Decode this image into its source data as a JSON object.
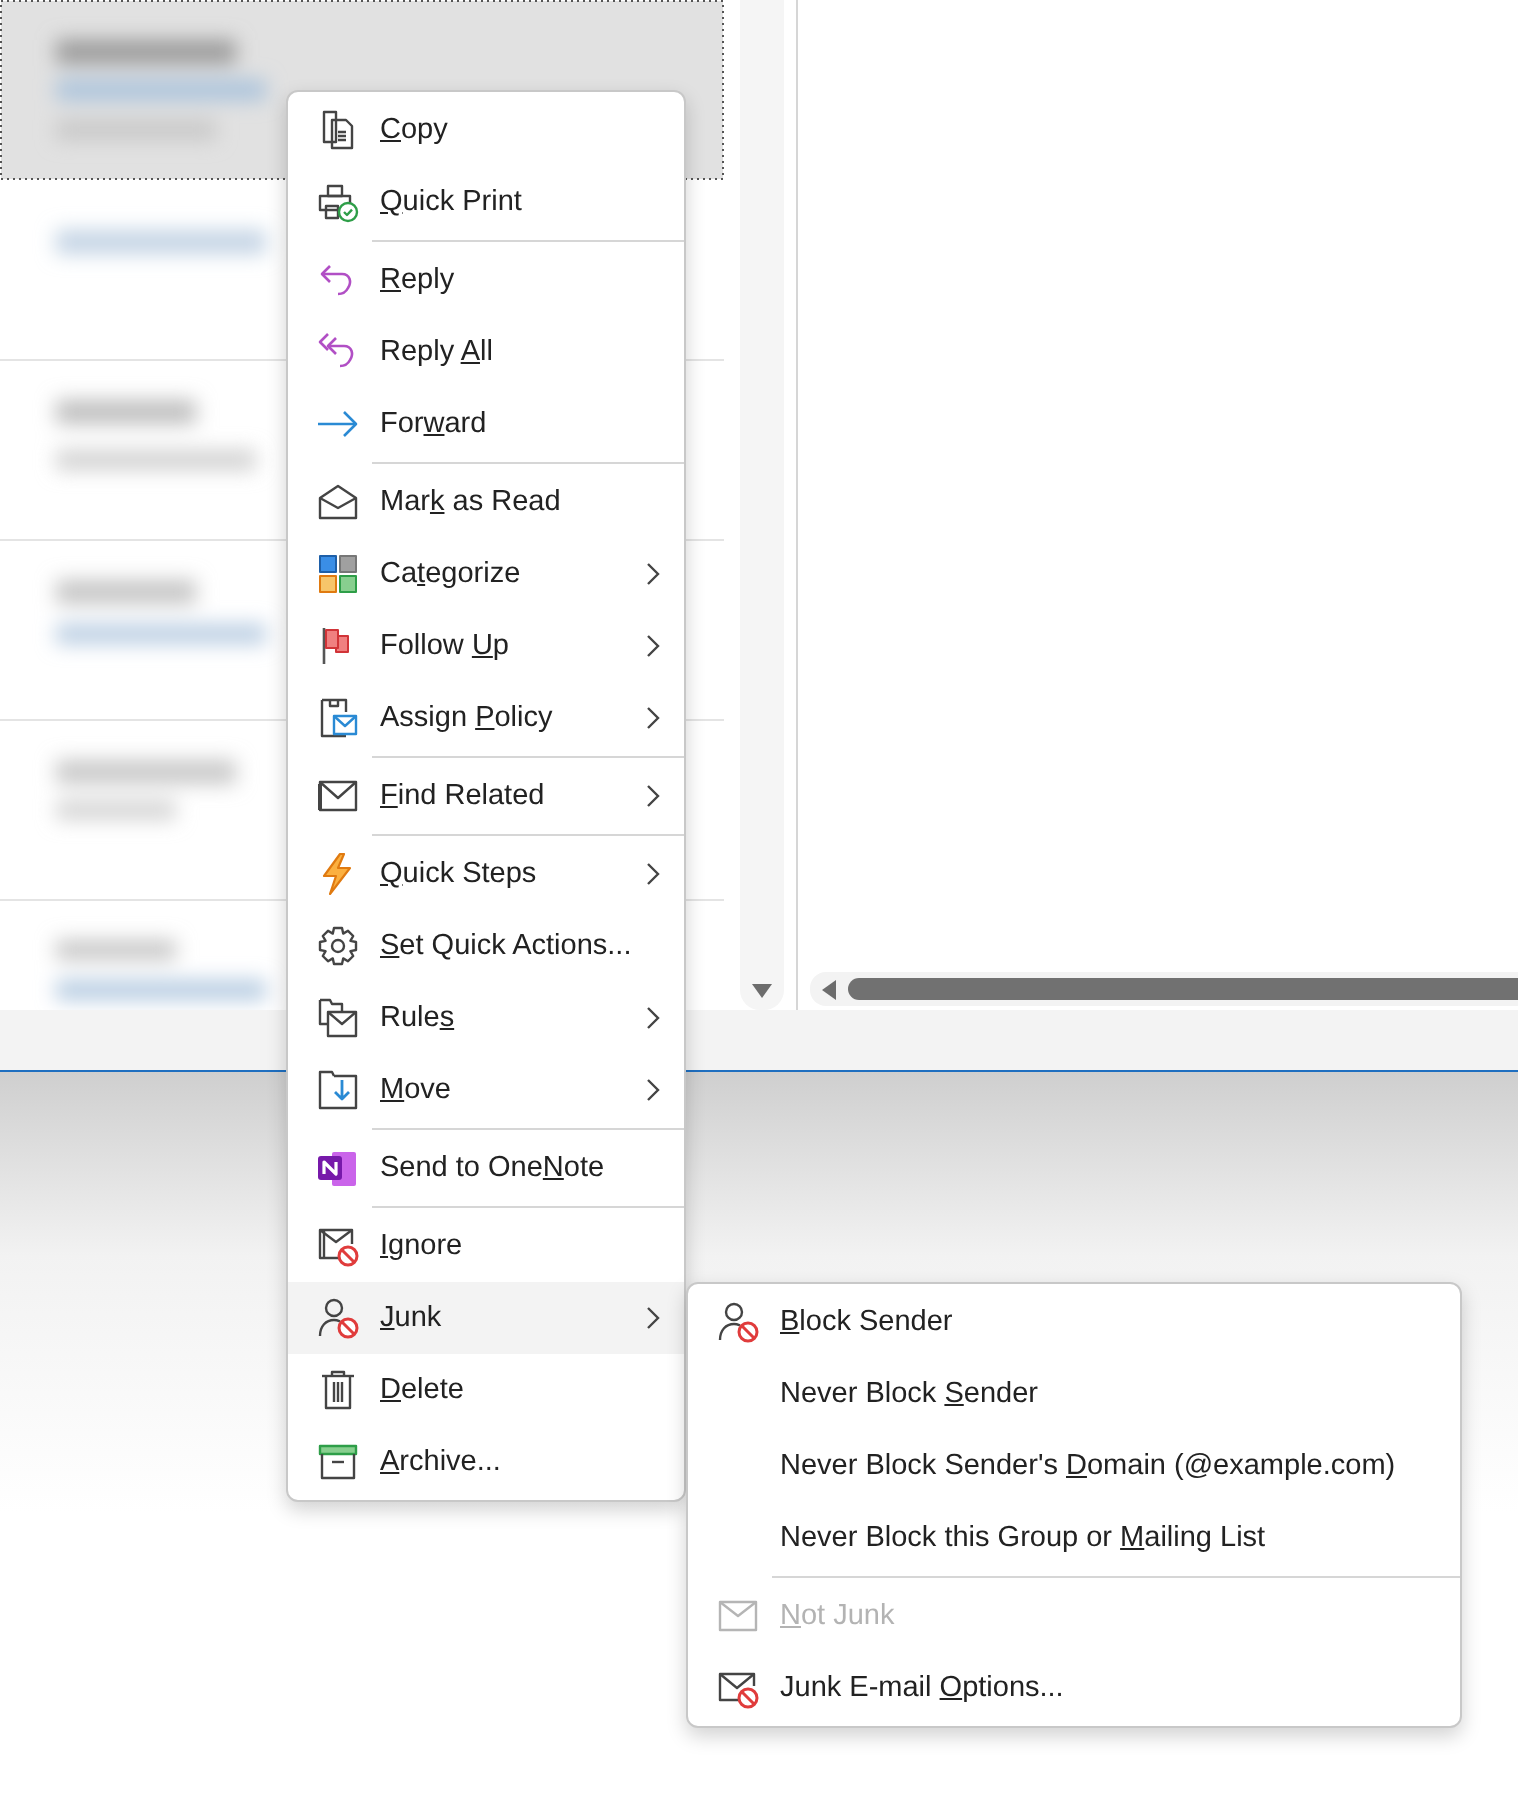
{
  "context_menu": {
    "groups": [
      {
        "items": [
          {
            "key": "C",
            "post": "opy",
            "selected": false,
            "has_submenu": false
          },
          {
            "key": "Q",
            "post": "uick Print",
            "selected": false,
            "has_submenu": false
          }
        ]
      },
      {
        "items": [
          {
            "key": "R",
            "post": "eply",
            "selected": false,
            "has_submenu": false
          },
          {
            "pre": "Reply ",
            "key": "A",
            "post": "ll",
            "selected": false,
            "has_submenu": false
          },
          {
            "pre": "For",
            "key": "w",
            "post": "ard",
            "selected": false,
            "has_submenu": false
          }
        ]
      },
      {
        "items": [
          {
            "pre": "Mar",
            "key": "k",
            "post": " as Read",
            "selected": false,
            "has_submenu": false
          },
          {
            "pre": "Ca",
            "key": "t",
            "post": "egorize",
            "selected": false,
            "has_submenu": true
          },
          {
            "pre": "Follow ",
            "key": "U",
            "post": "p",
            "selected": false,
            "has_submenu": true
          },
          {
            "pre": "Assign ",
            "key": "P",
            "post": "olicy",
            "selected": false,
            "has_submenu": true
          }
        ]
      },
      {
        "items": [
          {
            "key": "F",
            "post": "ind Related",
            "selected": false,
            "has_submenu": true
          }
        ]
      },
      {
        "items": [
          {
            "key": "Q",
            "post": "uick Steps",
            "selected": false,
            "has_submenu": true
          },
          {
            "key": "S",
            "post": "et Quick Actions...",
            "selected": false,
            "has_submenu": false
          },
          {
            "pre": "Rule",
            "key": "s",
            "selected": false,
            "has_submenu": true
          },
          {
            "key": "M",
            "post": "ove",
            "selected": false,
            "has_submenu": true
          }
        ]
      },
      {
        "items": [
          {
            "pre": "Send to One",
            "key": "N",
            "post": "ote",
            "selected": false,
            "has_submenu": false
          }
        ]
      },
      {
        "items": [
          {
            "key": "I",
            "post": "gnore",
            "selected": false,
            "has_submenu": false
          },
          {
            "key": "J",
            "post": "unk",
            "selected": true,
            "has_submenu": true
          },
          {
            "key": "D",
            "post": "elete",
            "selected": false,
            "has_submenu": false
          },
          {
            "key": "A",
            "post": "rchive...",
            "selected": false,
            "has_submenu": false
          }
        ]
      }
    ]
  },
  "submenu": {
    "groups": [
      {
        "items": [
          {
            "key": "B",
            "post": "lock Sender",
            "disabled": false
          },
          {
            "pre": "Never Block ",
            "key": "S",
            "post": "ender",
            "disabled": false
          },
          {
            "pre": "Never Block Sender's ",
            "key": "D",
            "post": "omain (@example.com)",
            "disabled": false
          },
          {
            "pre": "Never Block this Group or ",
            "key": "M",
            "post": "ailing List",
            "disabled": false
          }
        ]
      },
      {
        "items": [
          {
            "key": "N",
            "post": "ot Junk",
            "disabled": true
          },
          {
            "pre": "Junk E-mail ",
            "key": "O",
            "post": "ptions...",
            "disabled": false
          }
        ]
      }
    ]
  }
}
